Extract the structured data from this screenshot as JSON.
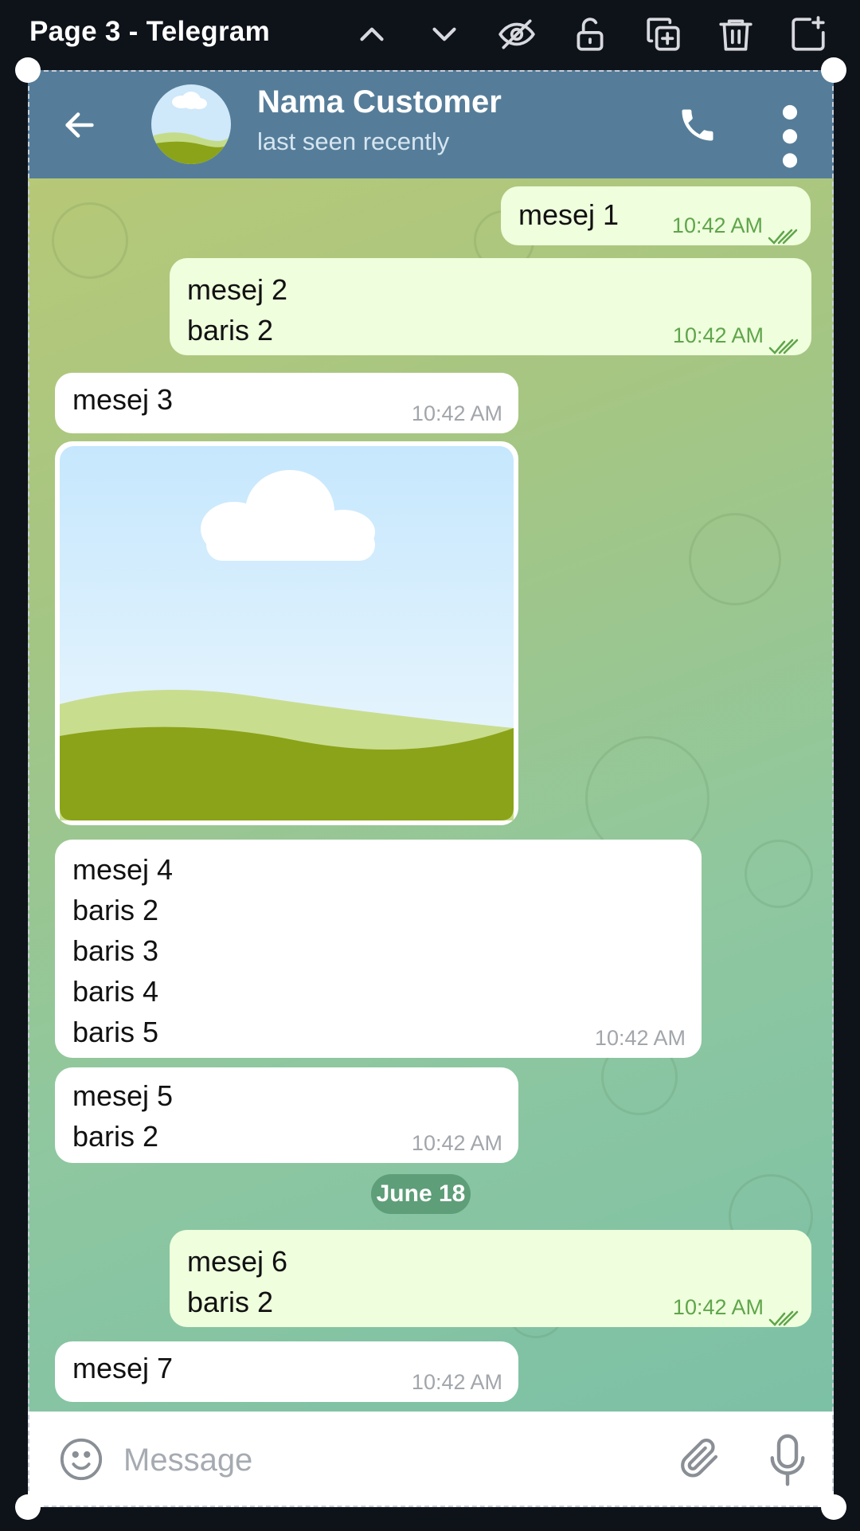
{
  "editor": {
    "page_title": "Page 3 - Telegram",
    "toolbar_icons": [
      "chevron-up-icon",
      "chevron-down-icon",
      "eye-off-icon",
      "unlock-icon",
      "duplicate-icon",
      "trash-icon",
      "add-page-icon"
    ]
  },
  "header": {
    "contact_name": "Nama Customer",
    "status": "last seen recently",
    "icons": [
      "back-arrow-icon",
      "phone-icon",
      "more-vertical-icon"
    ]
  },
  "messages": [
    {
      "dir": "out",
      "text": "mesej 1",
      "time": "10:42 AM",
      "ticks": "double-check-icon"
    },
    {
      "dir": "out",
      "text": "mesej 2\nbaris 2",
      "time": "10:42 AM",
      "ticks": "double-check-icon"
    },
    {
      "dir": "in",
      "text": "mesej 3",
      "time": "10:42 AM"
    },
    {
      "dir": "in",
      "type": "photo"
    },
    {
      "dir": "in",
      "text": "mesej 4\nbaris 2\nbaris 3\nbaris 4\nbaris 5",
      "time": "10:42 AM"
    },
    {
      "dir": "in",
      "text": "mesej 5\nbaris 2",
      "time": "10:42 AM"
    },
    {
      "dir": "out",
      "text": "mesej 6\nbaris 2",
      "time": "10:42 AM",
      "ticks": "double-check-icon"
    },
    {
      "dir": "in",
      "text": "mesej 7",
      "time": "10:42 AM"
    }
  ],
  "date_separator": "June 18",
  "composer": {
    "placeholder": "Message",
    "icons": [
      "emoji-icon",
      "attachment-icon",
      "microphone-icon"
    ]
  },
  "colors": {
    "header_bg": "#557d99",
    "outgoing_bubble": "#effedd",
    "incoming_bubble": "#ffffff",
    "accent_green": "#5fa54b",
    "date_pill": "#5e9e78"
  }
}
